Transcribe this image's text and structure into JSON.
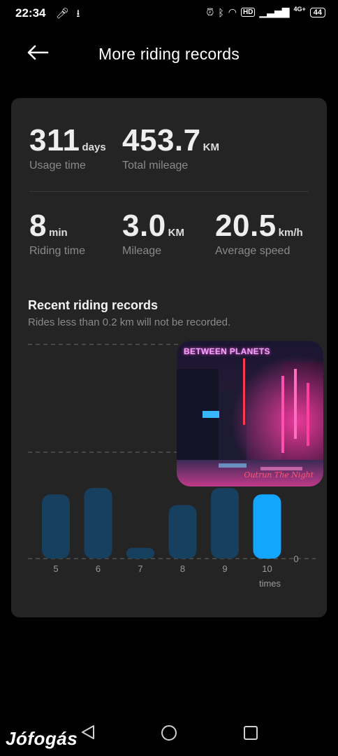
{
  "status_bar": {
    "time": "22:34",
    "network": "4G+",
    "battery": "44",
    "hd": "HD"
  },
  "header": {
    "title": "More riding records"
  },
  "stats": [
    {
      "value": "311",
      "unit": "days",
      "label": "Usage time"
    },
    {
      "value": "453.7",
      "unit": "KM",
      "label": "Total mileage"
    },
    {
      "value": "8",
      "unit": "min",
      "label": "Riding time"
    },
    {
      "value": "3.0",
      "unit": "KM",
      "label": "Mileage"
    },
    {
      "value": "20.5",
      "unit": "km/h",
      "label": "Average speed"
    }
  ],
  "records": {
    "title": "Recent riding records",
    "subtitle": "Rides less than 0.2 km will not be recorded."
  },
  "chart_data": {
    "type": "bar",
    "categories": [
      "5",
      "6",
      "7",
      "8",
      "9",
      "10"
    ],
    "values": [
      3.0,
      3.3,
      0.5,
      2.5,
      3.3,
      3.0
    ],
    "selected_index": 5,
    "xlabel": "times",
    "ylabel": "",
    "y_tick_label": "0",
    "ylim": [
      0,
      10
    ],
    "grid": true,
    "colors": {
      "bar": "#17405e",
      "selected": "#12a6ff",
      "grid": "#5a5a5a"
    }
  },
  "popup": {
    "title": "BETWEEN PLANETS",
    "signature": "Outrun The Night"
  },
  "watermark": "Jófogás",
  "colors": {
    "background": "#000000",
    "card": "#242424",
    "accent": "#12a6ff"
  }
}
